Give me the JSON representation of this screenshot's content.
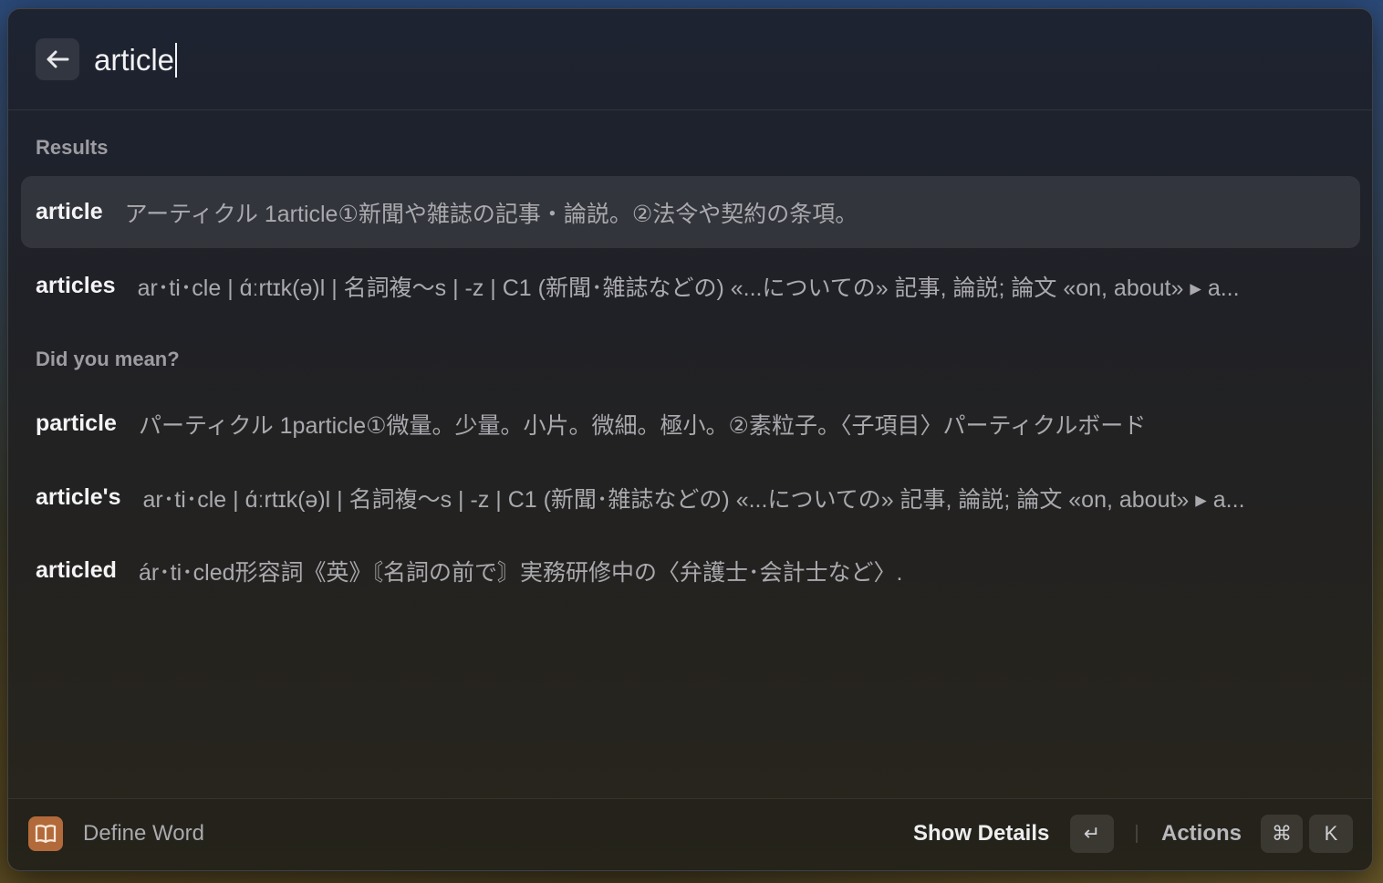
{
  "search": {
    "value": "article"
  },
  "sections": {
    "results_label": "Results",
    "did_you_mean_label": "Did you mean?"
  },
  "results": [
    {
      "word": "article",
      "definition": "アーティクル 1article①新聞や雑誌の記事・論説。②法令や契約の条項。"
    },
    {
      "word": "articles",
      "definition": "ar･ti･cle | ɑ́ːrtɪk(ə)l | 名詞複～s | -z | C1 (新聞･雑誌などの) «...についての» 記事, 論説; 論文 «on, about» ▸ a..."
    }
  ],
  "suggestions": [
    {
      "word": "particle",
      "definition": "パーティクル 1particle①微量。少量。小片。微細。極小。②素粒子。〈子項目〉パーティクルボード"
    },
    {
      "word": "article's",
      "definition": "ar･ti･cle | ɑ́ːrtɪk(ə)l | 名詞複～s | -z | C1 (新聞･雑誌などの) «...についての» 記事, 論説; 論文 «on, about» ▸ a..."
    },
    {
      "word": "articled",
      "definition": "ár･ti･cled形容詞《英》〘名詞の前で〙実務研修中の〈弁護士･会計士など〉."
    }
  ],
  "footer": {
    "command_title": "Define Word",
    "command_icon": "book-icon",
    "command_icon_color": "#b36a3a",
    "primary_action": "Show Details",
    "primary_key": "↵",
    "actions_label": "Actions",
    "actions_keys": [
      "⌘",
      "K"
    ]
  }
}
